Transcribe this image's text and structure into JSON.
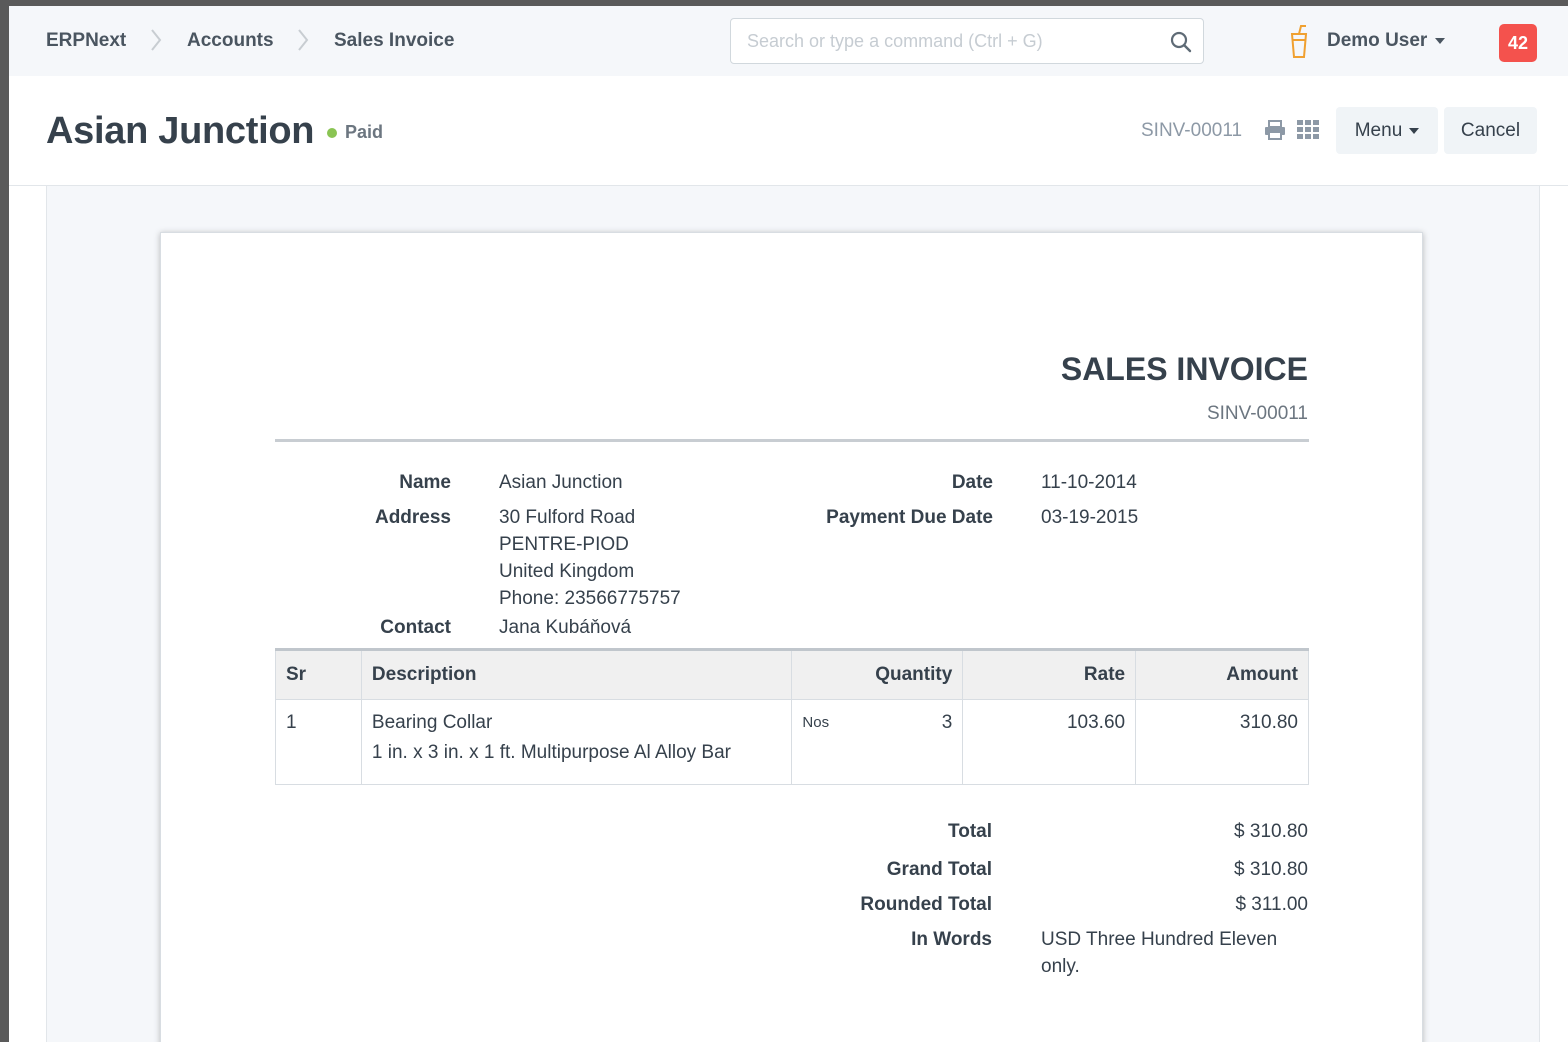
{
  "navbar": {
    "breadcrumbs": [
      "ERPNext",
      "Accounts",
      "Sales Invoice"
    ],
    "search_placeholder": "Search or type a command (Ctrl + G)",
    "user_name": "Demo User",
    "notification_count": "42",
    "icons": [
      "search-icon",
      "bell-icon",
      "caret-down-icon"
    ]
  },
  "page_head": {
    "title": "Asian Junction",
    "status": "Paid",
    "status_color": "#8ac453",
    "doc_id": "SINV-00011",
    "menu_label": "Menu",
    "cancel_label": "Cancel",
    "icons": [
      "printer-icon",
      "grid-icon"
    ]
  },
  "invoice": {
    "heading": "SALES INVOICE",
    "number": "SINV-00011",
    "customer": {
      "name_label": "Name",
      "name": "Asian Junction",
      "address_label": "Address",
      "address_lines": [
        "30 Fulford Road",
        "PENTRE-PIOD",
        "United Kingdom",
        "Phone: 23566775757"
      ],
      "contact_label": "Contact",
      "contact": "Jana Kubáňová"
    },
    "dates": {
      "date_label": "Date",
      "date": "11-10-2014",
      "due_label": "Payment Due Date",
      "due": "03-19-2015"
    },
    "table": {
      "headers": [
        "Sr",
        "Description",
        "Quantity",
        "Rate",
        "Amount"
      ],
      "rows": [
        {
          "sr": "1",
          "item": "Bearing Collar",
          "description": "1 in. x 3 in. x 1 ft. Multipurpose Al Alloy Bar",
          "uom": "Nos",
          "qty": "3",
          "rate": "103.60",
          "amount": "310.80"
        }
      ]
    },
    "totals": {
      "total_label": "Total",
      "total": "$ 310.80",
      "grand_total_label": "Grand Total",
      "grand_total": "$ 310.80",
      "rounded_total_label": "Rounded Total",
      "rounded_total": "$ 311.00",
      "in_words_label": "In Words",
      "in_words_line1": "USD Three Hundred Eleven",
      "in_words_line2": "only."
    }
  }
}
